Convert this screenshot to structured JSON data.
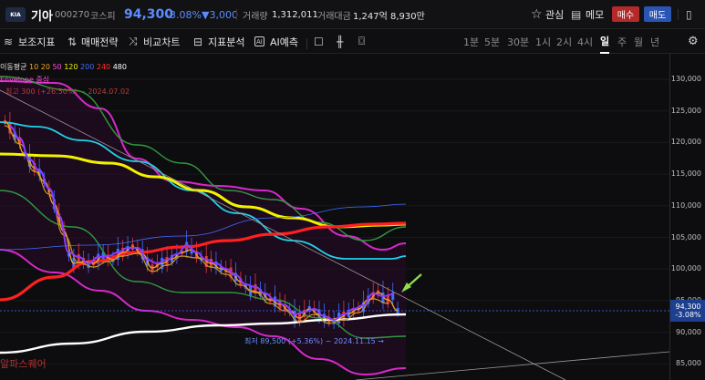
{
  "header": {
    "logo_text": "KIA",
    "name": "기아",
    "code": "000270",
    "market": "코스피",
    "price": "94,300",
    "change_pct": "-3.08%",
    "change_amt": "▼3,000",
    "volume_label": "거래량",
    "volume": "1,312,011",
    "amount_label": "거래대금",
    "amount": "1,247억 8,930만",
    "fav_label": "관심",
    "memo_label": "메모",
    "buy_label": "매수",
    "sell_label": "매도"
  },
  "toolbar": {
    "items": [
      "보조지표",
      "매매전략",
      "비교차트",
      "지표분석",
      "AI예측"
    ],
    "ai_badge": "AI",
    "intervals": [
      "1분",
      "5분",
      "30분",
      "1시",
      "2시",
      "4시",
      "일",
      "주",
      "월",
      "년"
    ],
    "active_interval": "일"
  },
  "legend": {
    "ma_label": "이동평균",
    "ma_periods": [
      "10",
      "20",
      "50",
      "120",
      "200",
      "240",
      "480"
    ],
    "ma_colors": [
      "#f5a623",
      "#f5a623",
      "#ff4fd8",
      "#f2f200",
      "#3f6fff",
      "#ff3030",
      "#ffffff"
    ],
    "envelope_label": "Envelope 중심",
    "line3": "최고 300 (+26.50%) ~ 2024.07.02"
  },
  "price_axis": {
    "ticks": [
      "130,000",
      "125,000",
      "120,000",
      "115,000",
      "110,000",
      "105,000",
      "100,000",
      "95,000",
      "90,000",
      "85,000"
    ],
    "current_price": "94,300",
    "current_change": "-3.08%"
  },
  "annotations": {
    "low_label": "최저 89,500 (+5.36%) ~ 2024.11.15 →",
    "watermark": "알파스퀘어"
  },
  "colors": {
    "up": "#e23b3b",
    "down": "#3f6fff",
    "accent_blue": "#5b8cff",
    "arrow_green": "#8ee04a"
  }
}
